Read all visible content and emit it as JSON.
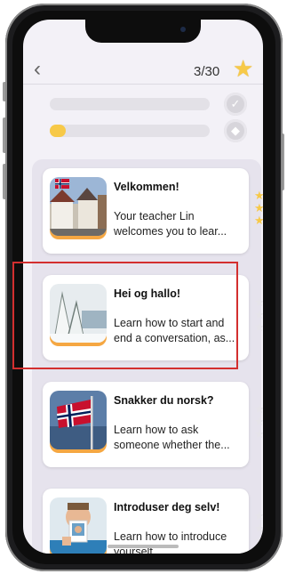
{
  "header": {
    "back_glyph": "‹",
    "progress_text": "3/30",
    "star_icon": "star-icon"
  },
  "progress_bars": [
    {
      "fill_percent": 0,
      "icon": "check-badge-icon",
      "icon_glyph": "✓"
    },
    {
      "fill_percent": 10,
      "icon": "badge-icon",
      "icon_glyph": "◆"
    }
  ],
  "lessons": [
    {
      "title": "Velkommen!",
      "desc": "Your teacher Lin welcomes you to lear...",
      "stars_earned": 3,
      "stars_total": 3,
      "image": "bergen-street-flag-photo"
    },
    {
      "title": "Hei og hallo!",
      "desc": "Learn how to start and end a conversation, as...",
      "stars_earned": 0,
      "stars_total": 3,
      "image": "snowy-trees-photo"
    },
    {
      "title": "Snakker du norsk?",
      "desc": "Learn how to ask someone whether the...",
      "stars_earned": 0,
      "stars_total": 3,
      "image": "norwegian-flag-photo"
    },
    {
      "title": "Introduser deg selv!",
      "desc": "Learn how to introduce yourself.",
      "stars_earned": 0,
      "stars_total": 3,
      "image": "man-with-photo-photo"
    }
  ],
  "colors": {
    "accent": "#f7c948",
    "highlight": "#d32f2f",
    "star_empty": "#e6e4ea"
  }
}
